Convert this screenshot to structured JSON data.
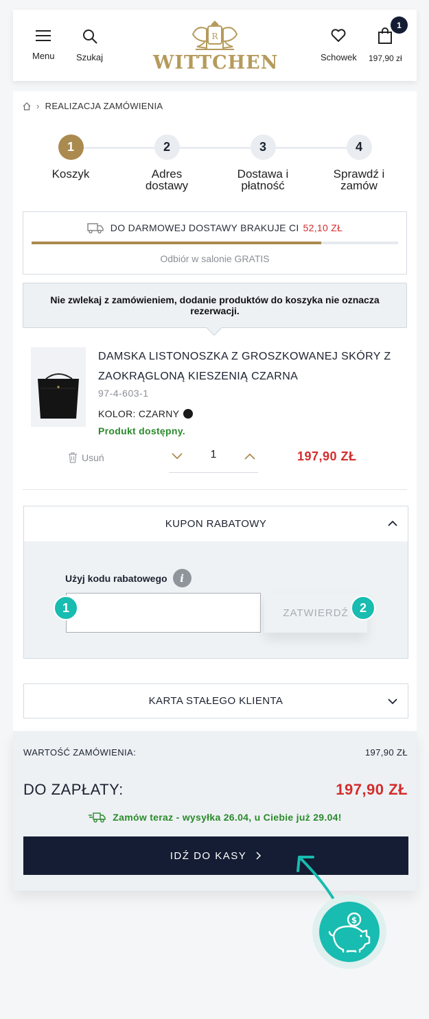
{
  "header": {
    "menu_label": "Menu",
    "search_label": "Szukaj",
    "brand": "WITTCHEN",
    "wishlist_label": "Schowek",
    "cart_total": "197,90 zł",
    "cart_count": "1"
  },
  "breadcrumb": {
    "current": "REALIZACJA ZAMÓWIENIA"
  },
  "steps": [
    {
      "number": "1",
      "title": "Koszyk",
      "active": true
    },
    {
      "number": "2",
      "title": "Adres dostawy",
      "active": false
    },
    {
      "number": "3",
      "title": "Dostawa i płatność",
      "active": false
    },
    {
      "number": "4",
      "title": "Sprawdź i zamów",
      "active": false
    }
  ],
  "shipping": {
    "text": "DO DARMOWEJ DOSTAWY BRAKUJE CI",
    "amount": "52,10 ZŁ",
    "progress": 0.79,
    "pickup_text": "Odbiór w salonie GRATIS"
  },
  "notice": "Nie zwlekaj z zamówieniem, dodanie produktów do koszyka nie oznacza rezerwacji.",
  "product": {
    "title": "DAMSKA LISTONOSZKA Z GROSZKOWANEJ SKÓRY Z ZAOKRĄGLONĄ KIESZENIĄ CZARNA",
    "sku": "97-4-603-1",
    "color_label": "KOLOR: CZARNY",
    "color_hex": "#1a1a1a",
    "availability": "Produkt dostępny.",
    "remove_label": "Usuń",
    "quantity": "1",
    "price": "197,90 ZŁ"
  },
  "coupon": {
    "header": "KUPON RABATOWY",
    "label": "Użyj kodu rabatowego",
    "info_icon": "i",
    "input_value": "",
    "submit_label": "ZATWIERDŹ",
    "marker1": "1",
    "marker2": "2"
  },
  "loyalty": {
    "header": "KARTA STAŁEGO KLIENTA"
  },
  "summary": {
    "order_value_label": "WARTOŚĆ ZAMÓWIENIA:",
    "order_value": "197,90 ZŁ",
    "to_pay_label": "DO ZAPŁATY:",
    "to_pay": "197,90 ZŁ",
    "delivery_info": "Zamów teraz - wysyłka 26.04, u Ciebie już 29.04!",
    "checkout_label": "IDŹ DO KASY"
  },
  "colors": {
    "accent_gold": "#ab8a4f",
    "navy": "#141d33",
    "price_red": "#d42c2c",
    "success_green": "#2a8a2a",
    "teal": "#18bcb0"
  }
}
